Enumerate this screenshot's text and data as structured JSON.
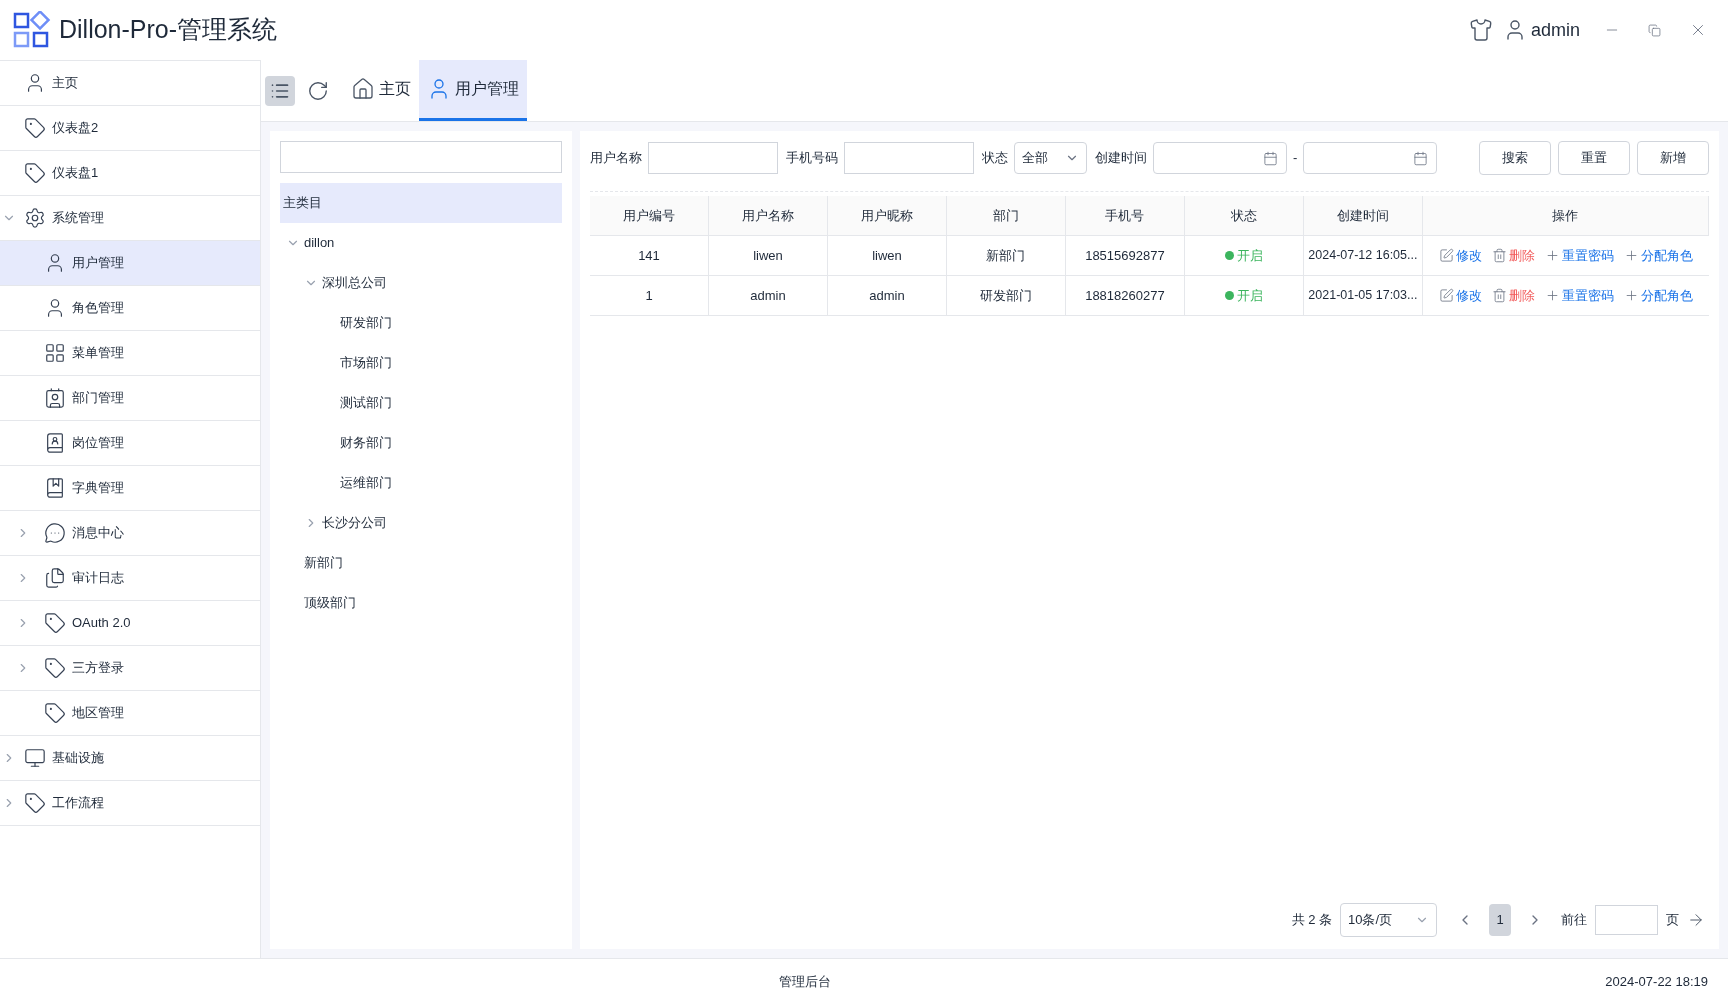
{
  "app": {
    "title": "Dillon-Pro-管理系统",
    "user": "admin"
  },
  "sidebar": {
    "items": [
      {
        "label": "主页",
        "selected": false
      },
      {
        "label": "仪表盘2",
        "selected": false
      },
      {
        "label": "仪表盘1",
        "selected": false
      },
      {
        "label": "系统管理",
        "selected": false,
        "expanded": true,
        "children": [
          {
            "label": "用户管理",
            "selected": true
          },
          {
            "label": "角色管理",
            "selected": false
          },
          {
            "label": "菜单管理",
            "selected": false
          },
          {
            "label": "部门管理",
            "selected": false
          },
          {
            "label": "岗位管理",
            "selected": false
          },
          {
            "label": "字典管理",
            "selected": false
          },
          {
            "label": "消息中心",
            "selected": false,
            "expanded": false
          },
          {
            "label": "审计日志",
            "selected": false,
            "expanded": false
          },
          {
            "label": "OAuth 2.0",
            "selected": false,
            "expanded": false
          },
          {
            "label": "三方登录",
            "selected": false,
            "expanded": false
          },
          {
            "label": "地区管理",
            "selected": false
          }
        ]
      },
      {
        "label": "基础设施",
        "selected": false,
        "expanded": false
      },
      {
        "label": "工作流程",
        "selected": false,
        "expanded": false
      }
    ]
  },
  "tabs": [
    {
      "label": "主页",
      "selected": false
    },
    {
      "label": "用户管理",
      "selected": true
    }
  ],
  "dept_tree": {
    "root": {
      "label": "主类目",
      "selected": true
    },
    "nodes": [
      {
        "label": "dillon",
        "selected": false,
        "expanded": true,
        "children": [
          {
            "label": "深圳总公司",
            "selected": false,
            "expanded": true,
            "children": [
              {
                "label": "研发部门",
                "selected": false
              },
              {
                "label": "市场部门",
                "selected": false
              },
              {
                "label": "测试部门",
                "selected": false
              },
              {
                "label": "财务部门",
                "selected": false
              },
              {
                "label": "运维部门",
                "selected": false
              }
            ]
          },
          {
            "label": "长沙分公司",
            "selected": false,
            "expanded": false
          }
        ]
      },
      {
        "label": "新部门",
        "selected": false
      },
      {
        "label": "顶级部门",
        "selected": false
      }
    ]
  },
  "filters": {
    "username_label": "用户名称",
    "phone_label": "手机号码",
    "status_label": "状态",
    "status_value": "全部",
    "created_label": "创建时间",
    "range_separator": "-",
    "buttons": [
      "搜索",
      "重置",
      "新增"
    ]
  },
  "table": {
    "columns": [
      "用户编号",
      "用户名称",
      "用户昵称",
      "部门",
      "手机号",
      "状态",
      "创建时间",
      "操作"
    ],
    "rows": [
      {
        "cells": [
          "141",
          "liwen",
          "liwen",
          "新部门",
          "18515692877"
        ],
        "status": {
          "text": "开启",
          "on": true
        },
        "created": "2024-07-12 16:05...",
        "actions": [
          {
            "kind": "edit",
            "label": "修改"
          },
          {
            "kind": "delete",
            "label": "删除"
          },
          {
            "kind": "add",
            "label": "重置密码"
          },
          {
            "kind": "add",
            "label": "分配角色"
          }
        ]
      },
      {
        "cells": [
          "1",
          "admin",
          "admin",
          "研发部门",
          "18818260277"
        ],
        "status": {
          "text": "开启",
          "on": true
        },
        "created": "2021-01-05 17:03...",
        "actions": [
          {
            "kind": "edit",
            "label": "修改"
          },
          {
            "kind": "delete",
            "label": "删除"
          },
          {
            "kind": "add",
            "label": "重置密码"
          },
          {
            "kind": "add",
            "label": "分配角色"
          }
        ]
      }
    ]
  },
  "pagination": {
    "total": "共 2 条",
    "page_size": "10条/页",
    "pages": [
      {
        "label": "1",
        "selected": true
      }
    ],
    "goto_label": "前往",
    "page_unit": "页"
  },
  "status_bar": {
    "center": "管理后台",
    "time": "2024-07-22 18:19"
  }
}
